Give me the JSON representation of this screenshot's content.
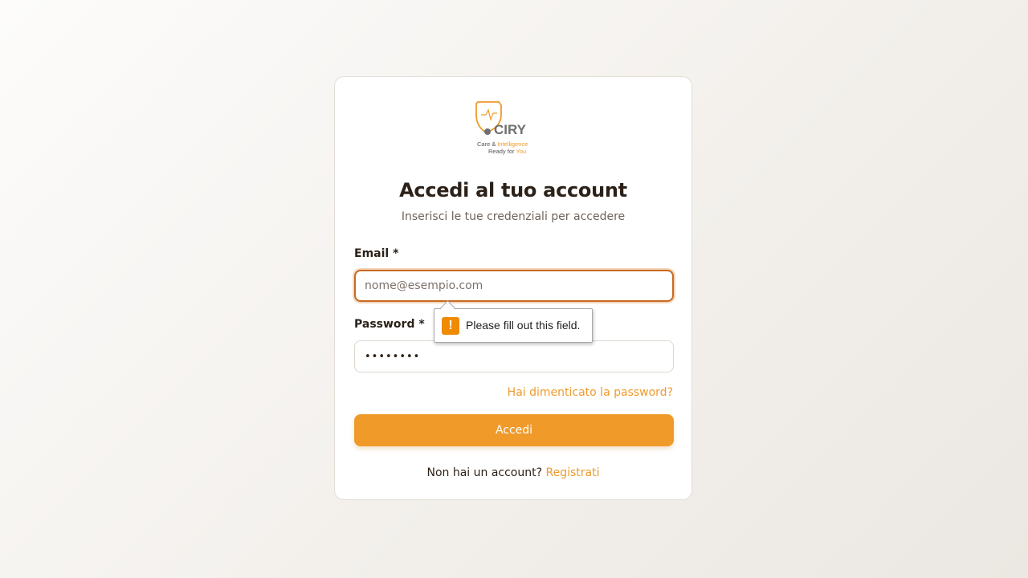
{
  "brand": {
    "logo_name": "CIRY",
    "logo_tagline_line1_a": "Care &",
    "logo_tagline_line1_b": "Intelligence",
    "logo_tagline_line2_a": "Ready for",
    "logo_tagline_line2_b": "You",
    "accent": "#f09a2a",
    "logo_gray": "#6f6f6f"
  },
  "login": {
    "title": "Accedi al tuo account",
    "subtitle": "Inserisci le tue credenziali per accedere",
    "email_label": "Email *",
    "email_placeholder": "nome@esempio.com",
    "password_label": "Password *",
    "password_value": "••••••••",
    "forgot_link": "Hai dimenticato la password?",
    "submit_label": "Accedi",
    "signup_prompt": "Non hai un account?",
    "signup_link": "Registrati"
  },
  "validation_tooltip": {
    "icon": "warning-icon",
    "message": "Please fill out this field."
  }
}
